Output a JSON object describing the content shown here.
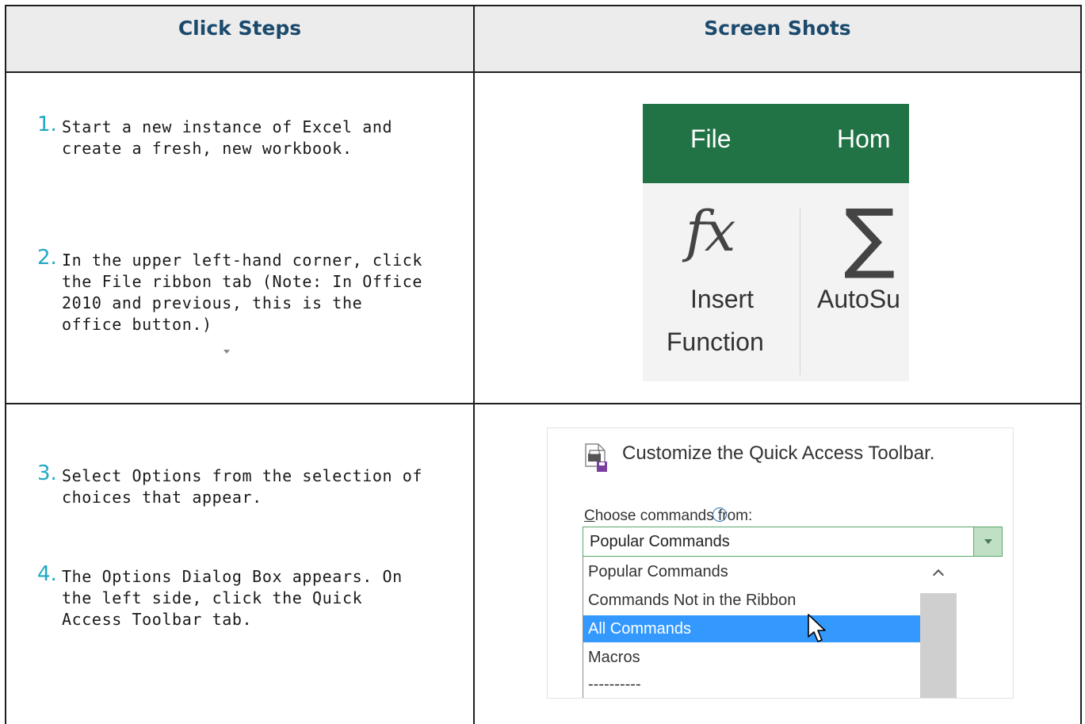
{
  "table": {
    "headers": [
      "Click Steps",
      "Screen Shots"
    ]
  },
  "steps": [
    {
      "num": "1.",
      "text": "Start a new instance of Excel and create a fresh, new workbook."
    },
    {
      "num": "2.",
      "text": "In the upper left-hand corner, click the File ribbon tab (Note: In Office 2010 and previous, this is the office button.)"
    },
    {
      "num": "3.",
      "text": "Select Options from the selection of choices that appear."
    },
    {
      "num": "4.",
      "text": "The Options Dialog Box appears. On the left side, click the Quick Access Toolbar tab."
    }
  ],
  "ribbon_shot": {
    "tabs": [
      "File",
      "Hom"
    ],
    "fx_symbol": "fx",
    "sigma_symbol": "∑",
    "insert_label_line1": "Insert",
    "insert_label_line2": "Function",
    "autosum_label": "AutoSu",
    "colors": {
      "ribbon_green": "#217346",
      "ribbon_body": "#f3f3f3"
    }
  },
  "options_shot": {
    "title": "Customize the Quick Access Toolbar.",
    "choose_label_first": "C",
    "choose_label_rest": "hoose commands from:",
    "info_symbol": "i",
    "selected_value": "Popular Commands",
    "list_items": [
      "Popular Commands",
      "Commands Not in the Ribbon",
      "All Commands",
      "Macros",
      "----------"
    ],
    "highlighted_item": "All Commands",
    "colors": {
      "highlight": "#3399ff",
      "select_border": "#5aa86b"
    }
  }
}
